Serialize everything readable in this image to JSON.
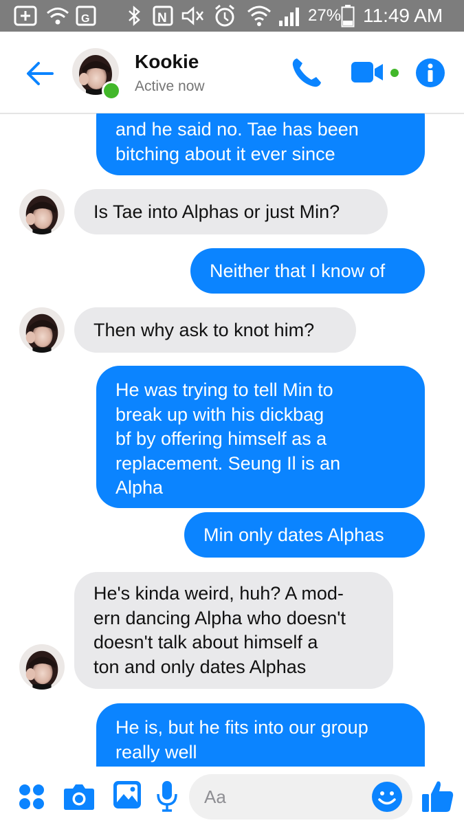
{
  "status_bar": {
    "battery": "27%",
    "time": "11:49 AM"
  },
  "header": {
    "contact_name": "Kookie",
    "status": "Active now"
  },
  "messages": [
    {
      "side": "out",
      "lines": [
        "and he said no. Tae has been",
        "bitching about it ever since"
      ]
    },
    {
      "side": "in",
      "lines": [
        "Is Tae into Alphas or just Min?"
      ]
    },
    {
      "side": "out",
      "lines": [
        "Neither that I know of"
      ]
    },
    {
      "side": "in",
      "lines": [
        "Then why ask to knot him?"
      ]
    },
    {
      "side": "out",
      "lines": [
        "He was trying to tell Min to",
        "break up with his dickbag",
        "bf by offering himself as a",
        "replacement. Seung Il is an",
        "Alpha"
      ]
    },
    {
      "side": "out",
      "lines": [
        "Min only dates Alphas"
      ]
    },
    {
      "side": "in",
      "lines": [
        "He's kinda weird, huh? A mod-",
        "ern dancing Alpha who doesn't",
        "doesn't talk about himself a",
        "ton and only dates Alphas"
      ]
    },
    {
      "side": "out",
      "lines": [
        "He is, but he fits into our group",
        "really well"
      ]
    }
  ],
  "composer": {
    "placeholder": "Aa"
  },
  "colors": {
    "accent": "#0b84ff",
    "incoming_bubble": "#e9e9eb",
    "status_bar": "#7d7d7d",
    "online": "#42b72a"
  },
  "icons": [
    "plus-box-icon",
    "wifi-icon",
    "gallery-icon",
    "bluetooth-icon",
    "nfc-icon",
    "mute-icon",
    "alarm-icon",
    "signal-icon",
    "battery-icon",
    "back-arrow-icon",
    "phone-icon",
    "video-icon",
    "info-icon",
    "apps-grid-icon",
    "camera-icon",
    "image-icon",
    "microphone-icon",
    "emoji-icon",
    "thumbs-up-icon"
  ]
}
